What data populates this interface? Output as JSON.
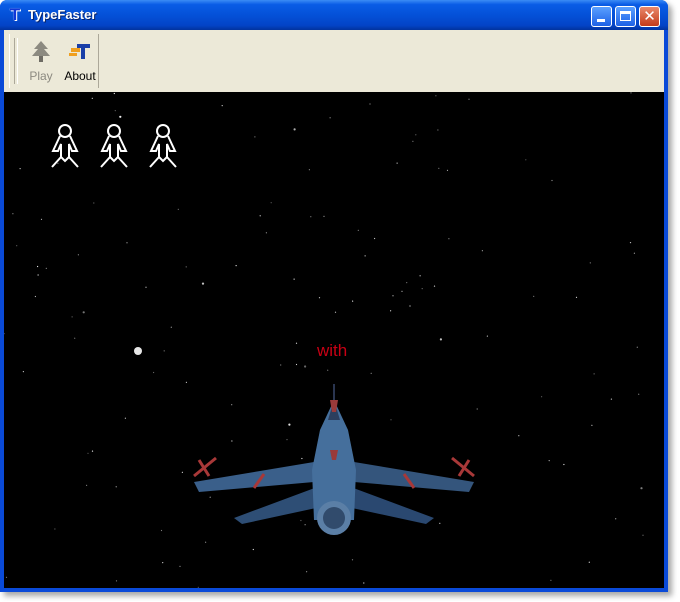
{
  "window": {
    "title": "TypeFaster",
    "app_icon_glyph": "T",
    "controls": {
      "minimize": "minimize-icon",
      "maximize": "maximize-icon",
      "close": "close-icon"
    }
  },
  "toolbar": {
    "buttons": [
      {
        "label": "Play",
        "icon": "tree-icon",
        "enabled": false
      },
      {
        "label": "About",
        "icon": "typefaster-logo-icon",
        "enabled": true
      }
    ]
  },
  "game": {
    "lives": 3,
    "current_word": "with",
    "word_color": "#c80014",
    "background": "#000000",
    "player_ship": "fighter-jet"
  },
  "colors": {
    "titlebar": "#0451d8",
    "toolbar_bg": "#ece9d8",
    "jet_body": "#3a5f8a"
  }
}
